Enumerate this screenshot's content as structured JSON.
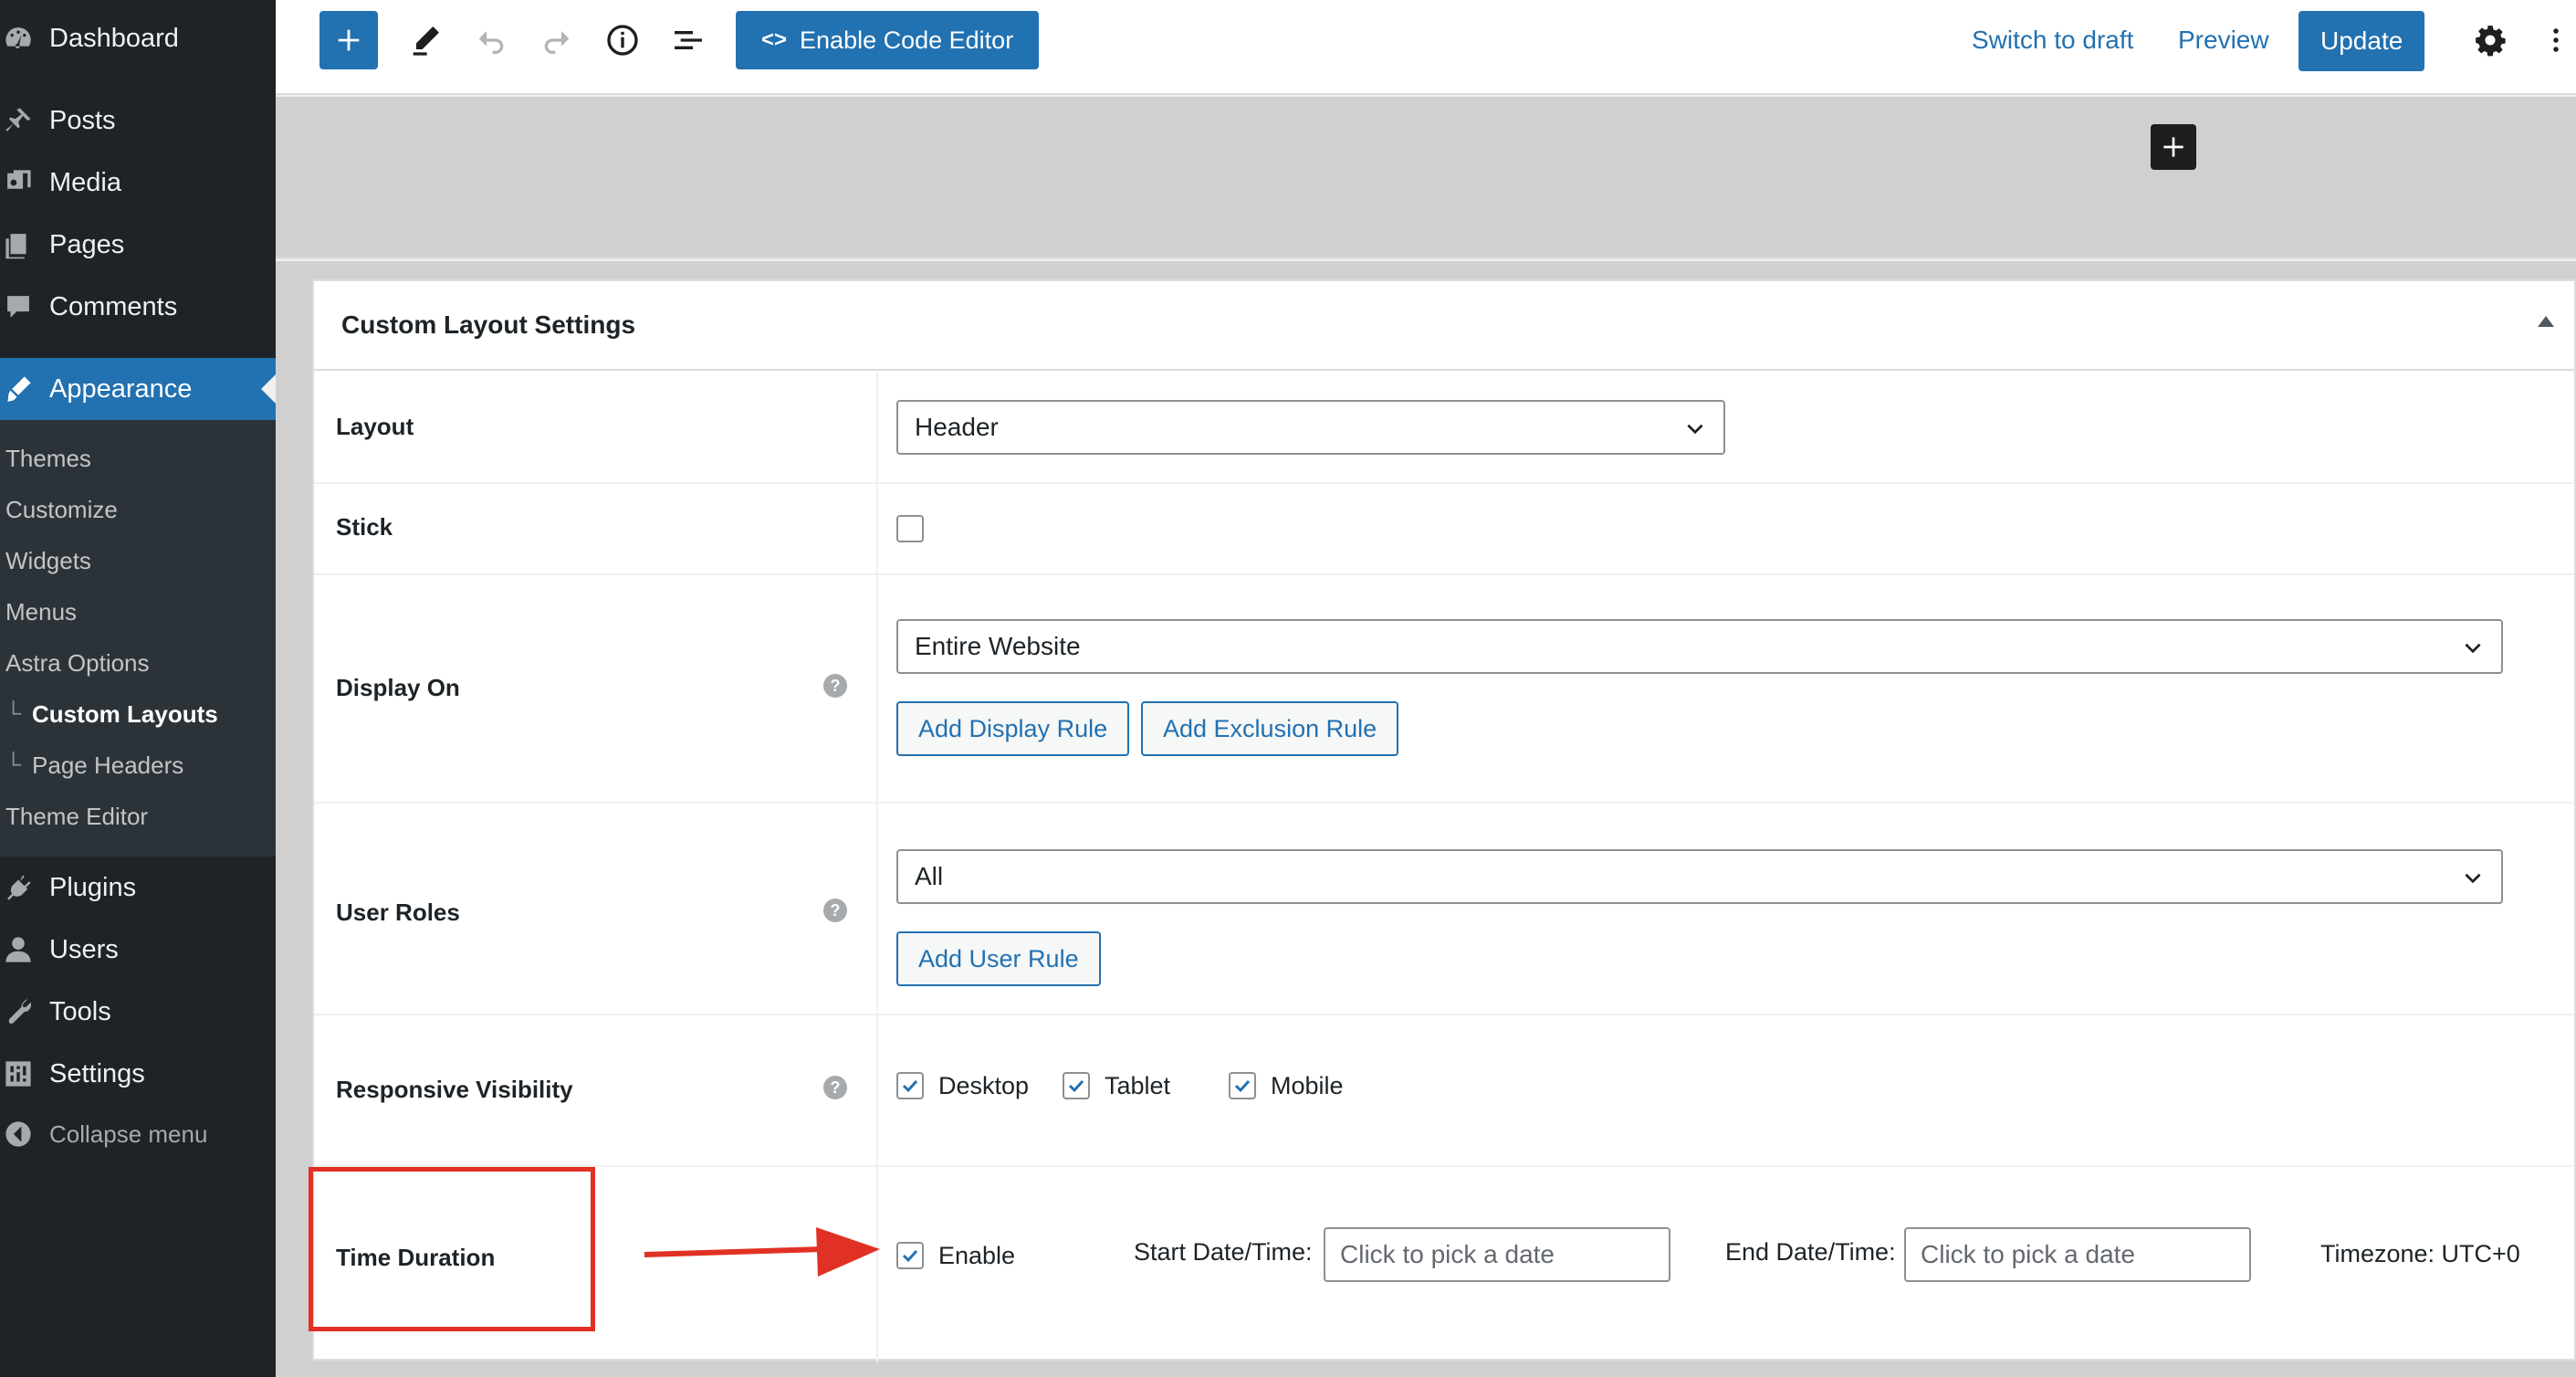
{
  "sidebar": {
    "items": [
      {
        "label": "Dashboard",
        "icon": "dashboard-icon"
      },
      {
        "label": "Posts",
        "icon": "pin-icon"
      },
      {
        "label": "Media",
        "icon": "media-icon"
      },
      {
        "label": "Pages",
        "icon": "pages-icon"
      },
      {
        "label": "Comments",
        "icon": "comment-icon"
      },
      {
        "label": "Appearance",
        "icon": "paintbrush-icon",
        "active": true
      },
      {
        "label": "Plugins",
        "icon": "plugin-icon"
      },
      {
        "label": "Users",
        "icon": "user-icon"
      },
      {
        "label": "Tools",
        "icon": "wrench-icon"
      },
      {
        "label": "Settings",
        "icon": "settings-icon"
      },
      {
        "label": "Collapse menu",
        "icon": "collapse-icon"
      }
    ],
    "submenu": [
      {
        "label": "Themes"
      },
      {
        "label": "Customize"
      },
      {
        "label": "Widgets"
      },
      {
        "label": "Menus"
      },
      {
        "label": "Astra Options"
      },
      {
        "label": "Custom Layouts",
        "current": true,
        "indent": "└"
      },
      {
        "label": "Page Headers",
        "indent": "└"
      },
      {
        "label": "Theme Editor"
      }
    ]
  },
  "toolbar": {
    "code_editor_label": "Enable Code Editor",
    "switch_to_draft": "Switch to draft",
    "preview": "Preview",
    "update": "Update"
  },
  "metabox": {
    "title": "Custom Layout Settings",
    "layout": {
      "label": "Layout",
      "value": "Header"
    },
    "stick": {
      "label": "Stick",
      "checked": false
    },
    "display_on": {
      "label": "Display On",
      "value": "Entire Website",
      "add_display_rule": "Add Display Rule",
      "add_exclusion_rule": "Add Exclusion Rule"
    },
    "user_roles": {
      "label": "User Roles",
      "value": "All",
      "add_user_rule": "Add User Rule"
    },
    "responsive": {
      "label": "Responsive Visibility",
      "options": [
        {
          "label": "Desktop",
          "checked": true
        },
        {
          "label": "Tablet",
          "checked": true
        },
        {
          "label": "Mobile",
          "checked": true
        }
      ]
    },
    "time_duration": {
      "label": "Time Duration",
      "enable_label": "Enable",
      "enabled": true,
      "start_label": "Start Date/Time:",
      "start_placeholder": "Click to pick a date",
      "end_label": "End Date/Time:",
      "end_placeholder": "Click to pick a date",
      "timezone": "Timezone: UTC+0"
    },
    "help_glyph": "?"
  },
  "colors": {
    "accent": "#2271b1",
    "sidebar_bg": "#1d2327",
    "annotation": "#e03124"
  }
}
